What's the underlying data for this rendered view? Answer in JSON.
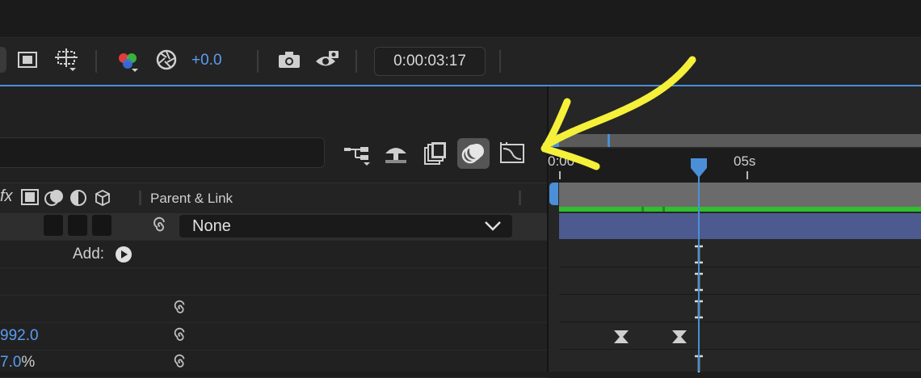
{
  "toolbar": {
    "exposure_value": "+0.0",
    "timecode": "0:00:03:17",
    "icons": [
      "region-of-interest-icon",
      "transparency-grid-icon",
      "channel-icon",
      "exposure-reset-icon",
      "snapshot-icon",
      "show-snapshot-icon"
    ]
  },
  "switches": {
    "icons": [
      "composition-flowchart-icon",
      "draft-3d-icon",
      "frame-blending-icon",
      "motion-blur-icon",
      "graph-editor-icon"
    ],
    "active": "motion-blur-icon"
  },
  "columns": {
    "fx_label": "fx",
    "parent_link_label": "Parent & Link"
  },
  "layer": {
    "parent_value": "None"
  },
  "properties": {
    "add_label": "Add:",
    "value_1": "992.0",
    "value_2": "7.0",
    "value_2_unit": "%"
  },
  "timeline": {
    "ruler_start": "0:00",
    "ruler_05s": "05s"
  },
  "colors": {
    "accent_blue": "#4a8fd8",
    "value_blue": "#5b9cf0",
    "layer_green": "#2fbf2f",
    "layer_bar_blue": "#4d5a8f",
    "annotation_yellow": "#f5f03a"
  }
}
